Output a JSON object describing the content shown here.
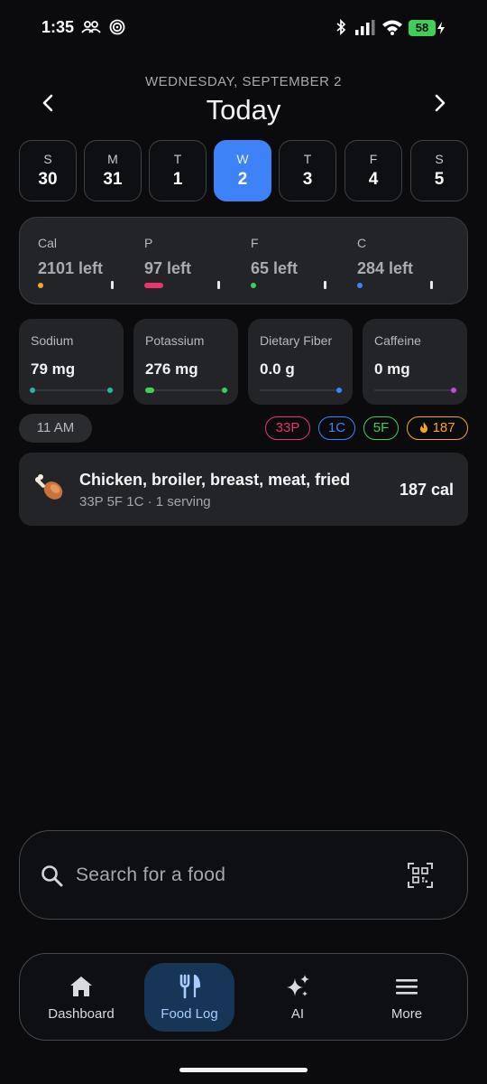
{
  "status_bar": {
    "time": "1:35",
    "battery": "58"
  },
  "header": {
    "date": "WEDNESDAY, SEPTEMBER 2",
    "title": "Today"
  },
  "week": [
    {
      "letter": "S",
      "number": "30",
      "selected": false
    },
    {
      "letter": "M",
      "number": "31",
      "selected": false
    },
    {
      "letter": "T",
      "number": "1",
      "selected": false
    },
    {
      "letter": "W",
      "number": "2",
      "selected": true
    },
    {
      "letter": "T",
      "number": "3",
      "selected": false
    },
    {
      "letter": "F",
      "number": "4",
      "selected": false
    },
    {
      "letter": "S",
      "number": "5",
      "selected": false
    }
  ],
  "macros": [
    {
      "label": "Cal",
      "value": "2101 left",
      "color": "#f5a524",
      "progress": 0.04
    },
    {
      "label": "P",
      "value": "97 left",
      "color": "#e8356b",
      "progress": 0.25
    },
    {
      "label": "F",
      "value": "65 left",
      "color": "#3ecf5a",
      "progress": 0.07
    },
    {
      "label": "C",
      "value": "284 left",
      "color": "#3d82f6",
      "progress": 0.0
    }
  ],
  "nutrients": [
    {
      "label": "Sodium",
      "value": "79 mg",
      "color": "#26b6a3"
    },
    {
      "label": "Potassium",
      "value": "276 mg",
      "color": "#3ecf5a"
    },
    {
      "label": "Dietary Fiber",
      "value": "0.0 g",
      "color": "#3d82f6"
    },
    {
      "label": "Caffeine",
      "value": "0 mg",
      "color": "#b64dd6"
    }
  ],
  "meal": {
    "time": "11 AM",
    "badges": [
      {
        "text": "33P",
        "color": "#e8356b"
      },
      {
        "text": "1C",
        "color": "#3d82f6"
      },
      {
        "text": "5F",
        "color": "#3ecf5a"
      },
      {
        "text": "187",
        "color": "#f5a524",
        "icon": "flame-icon"
      }
    ]
  },
  "food_entry": {
    "icon": "poultry-leg-icon",
    "name": "Chicken, broiler, breast, meat, fried",
    "detail": "33P 5F 1C · 1 serving",
    "calories": "187 cal"
  },
  "search": {
    "placeholder": "Search for a food"
  },
  "bottom_nav": [
    {
      "label": "Dashboard",
      "icon": "home-icon",
      "active": false
    },
    {
      "label": "Food Log",
      "icon": "fork-knife-icon",
      "active": true
    },
    {
      "label": "AI",
      "icon": "sparkles-icon",
      "active": false
    },
    {
      "label": "More",
      "icon": "menu-icon",
      "active": false
    }
  ]
}
